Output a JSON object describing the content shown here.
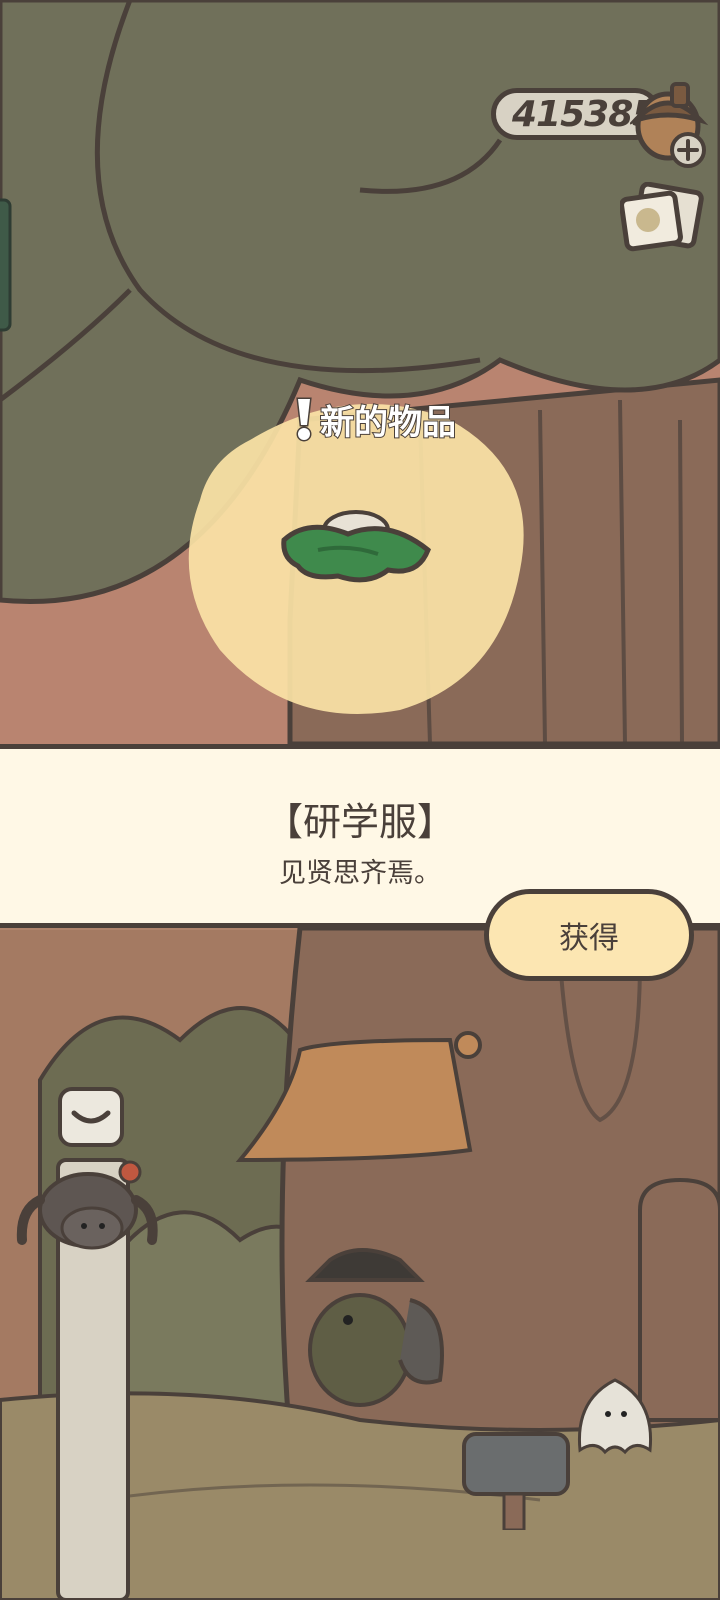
{
  "hud": {
    "currency_value": "415385",
    "currency_icon": "acorn-icon",
    "add_icon": "plus-icon",
    "album_icon": "photo-album-icon"
  },
  "popup": {
    "alert_icon": "exclamation-icon",
    "title": "新的物品",
    "item_icon": "green-clothing-icon"
  },
  "item": {
    "name": "【研学服】",
    "description": "见贤思齐焉。"
  },
  "actions": {
    "get_label": "获得"
  },
  "scene": {
    "mailbox_icon": "mailbox-icon",
    "menu_icon": "chevron-down-icon",
    "characters": [
      "spider",
      "frog-traveler",
      "ghost"
    ]
  }
}
